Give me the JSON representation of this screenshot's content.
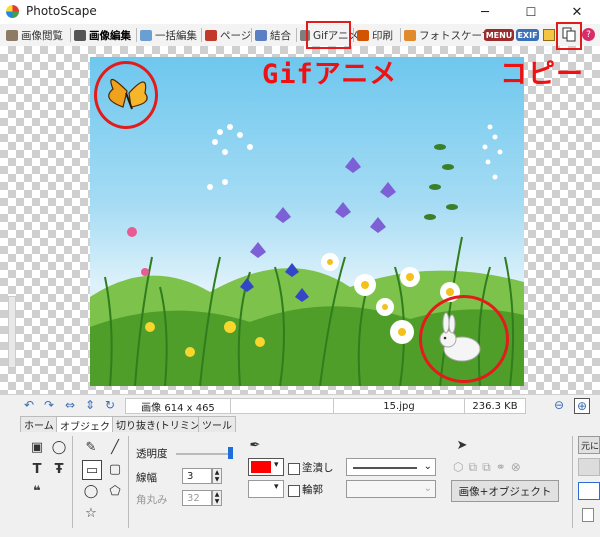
{
  "window": {
    "title": "PhotoScape",
    "controls": [
      "─",
      "☐",
      "✕"
    ]
  },
  "tabs": [
    {
      "label": "画像閲覧",
      "icon": "viewer-icon"
    },
    {
      "label": "画像編集",
      "icon": "editor-icon",
      "active": true
    },
    {
      "label": "一括編集",
      "icon": "batch-icon"
    },
    {
      "label": "ページ",
      "icon": "page-icon"
    },
    {
      "label": "結合",
      "icon": "combine-icon"
    },
    {
      "label": "Gifアニメ",
      "icon": "gif-icon"
    },
    {
      "label": "印刷",
      "icon": "print-icon"
    },
    {
      "label": "フォトスケープ",
      "icon": "photoscape-icon"
    }
  ],
  "toolbar_badges": {
    "menu": "MENU",
    "exif": "EXIF"
  },
  "status": {
    "dimensions": "画像 614 x 465",
    "filename": "15.jpg",
    "filesize": "236.3 KB"
  },
  "bottom_tabs": [
    "ホーム",
    "オブジェクト",
    "切り抜き(トリミング)",
    "ツール"
  ],
  "panel": {
    "opacity_label": "透明度",
    "line_width_label": "線幅",
    "line_width_value": "3",
    "corner_label": "角丸み",
    "corner_value": "32",
    "fill_label": "塗潰し",
    "outline_label": "輪郭",
    "image_object_button": "画像+オブジェクト",
    "original_button": "元に",
    "color": "#ff0000"
  },
  "annotations": {
    "gif_label": "Gifアニメ",
    "copy_label": "コピー"
  }
}
